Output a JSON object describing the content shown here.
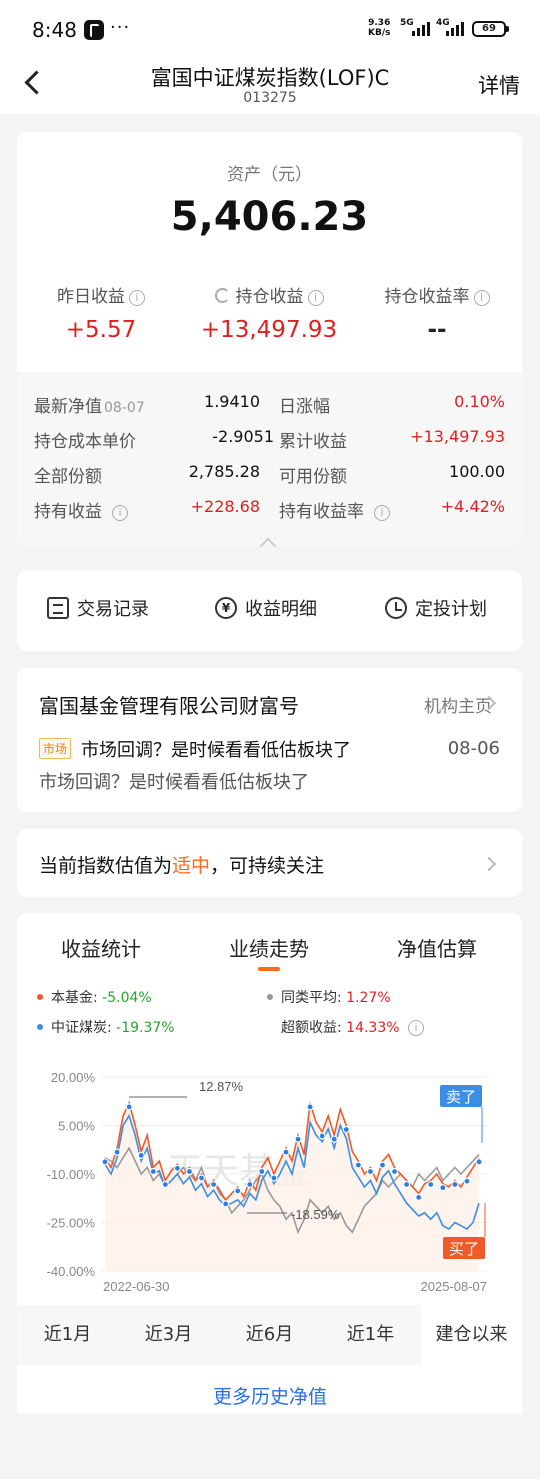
{
  "status": {
    "time": "8:48",
    "dots": "···",
    "net_speed_top": "9.36",
    "net_speed_bottom": "KB/s",
    "sig1": "5G",
    "sig2": "4G",
    "battery": "69"
  },
  "nav": {
    "title": "富国中证煤炭指数(LOF)C",
    "code": "013275",
    "detail": "详情"
  },
  "assets": {
    "label": "资产（元）",
    "value": "5,406.23",
    "stats": [
      {
        "label": "昨日收益",
        "value": "+5.57"
      },
      {
        "label": "持仓收益",
        "value": "+13,497.93"
      },
      {
        "label": "持仓收益率",
        "value": "--"
      }
    ]
  },
  "details": {
    "rows": [
      {
        "l_label": "最新净值",
        "l_sub": "08-07",
        "l_value": "1.9410",
        "r_label": "日涨幅",
        "r_value": "0.10%"
      },
      {
        "l_label": "持仓成本单价",
        "l_sub": "",
        "l_value": "-2.9051",
        "r_label": "累计收益",
        "r_value": "+13,497.93"
      },
      {
        "l_label": "全部份额",
        "l_sub": "",
        "l_value": "2,785.28",
        "r_label": "可用份额",
        "r_value": "100.00"
      },
      {
        "l_label": "持有收益",
        "l_sub": "",
        "l_value": "+228.68",
        "r_label": "持有收益率",
        "r_value": "+4.42%"
      }
    ]
  },
  "actions": [
    "交易记录",
    "收益明细",
    "定投计划"
  ],
  "wealth": {
    "title": "富国基金管理有限公司财富号",
    "link": "机构主页",
    "tag": "市场",
    "news_title": "市场回调？是时候看看低估板块了",
    "news_date": "08-06",
    "news_sub": "市场回调？是时候看看低估板块了"
  },
  "valuation": {
    "prefix": "当前指数估值为",
    "highlight": "适中",
    "suffix": "，可持续关注"
  },
  "perf": {
    "tabs": [
      "收益统计",
      "业绩走势",
      "净值估算"
    ],
    "active_tab": 1,
    "legend": [
      {
        "name": "本基金:",
        "value": "-5.04%",
        "color": "#f05a28",
        "value_color": "#2aa52a"
      },
      {
        "name": "同类平均:",
        "value": "1.27%",
        "color": "#999999",
        "value_color": "#e02020"
      },
      {
        "name": "中证煤炭:",
        "value": "-19.37%",
        "color": "#3a8ee6",
        "value_color": "#2aa52a"
      },
      {
        "name": "超额收益:",
        "value": "14.33%",
        "color": "",
        "value_color": "#e02020"
      }
    ],
    "ranges": [
      "近1月",
      "近3月",
      "近6月",
      "近1年",
      "建仓以来"
    ],
    "active_range": 4,
    "more": "更多历史净值"
  },
  "chart_data": {
    "type": "line",
    "y_ticks": [
      "20.00%",
      "5.00%",
      "-10.00%",
      "-25.00%",
      "-40.00%"
    ],
    "ylim": [
      -40,
      20
    ],
    "x_start": "2022-06-30",
    "x_end": "2025-08-07",
    "annotations": {
      "max": "12.87%",
      "min": "-18.59%",
      "sell": "卖了",
      "buy": "买了"
    },
    "watermark": "天天基金",
    "series": [
      {
        "name": "本基金",
        "color": "#f05a28",
        "values": [
          -5,
          -8,
          -2,
          8,
          12,
          5,
          -3,
          2,
          -8,
          -6,
          -12,
          -9,
          -7,
          -10,
          -8,
          -12,
          -10,
          -14,
          -12,
          -15,
          -18,
          -16,
          -14,
          -17,
          -12,
          -15,
          -8,
          -5,
          -10,
          -6,
          -2,
          -6,
          2,
          -4,
          12,
          6,
          3,
          8,
          2,
          10,
          5,
          -3,
          -6,
          -10,
          -8,
          -12,
          -6,
          -4,
          -8,
          -10,
          -12,
          -14,
          -16,
          -13,
          -12,
          -10,
          -13,
          -14,
          -12,
          -14,
          -11,
          -8,
          -5
        ]
      },
      {
        "name": "同类平均",
        "color": "#999999",
        "values": [
          -5,
          -6,
          -8,
          -5,
          -2,
          -6,
          -10,
          -8,
          -12,
          -10,
          -14,
          -12,
          -10,
          -8,
          -10,
          -12,
          -8,
          -14,
          -12,
          -16,
          -18,
          -22,
          -20,
          -18,
          -15,
          -12,
          -10,
          -15,
          -18,
          -20,
          -24,
          -22,
          -28,
          -24,
          -18,
          -20,
          -22,
          -20,
          -24,
          -22,
          -26,
          -28,
          -24,
          -20,
          -18,
          -16,
          -12,
          -14,
          -12,
          -10,
          -12,
          -14,
          -10,
          -12,
          -10,
          -8,
          -12,
          -10,
          -8,
          -10,
          -8,
          -6,
          -4
        ]
      },
      {
        "name": "中证煤炭",
        "color": "#3a8ee6",
        "values": [
          -7,
          -10,
          -5,
          5,
          8,
          2,
          -6,
          -2,
          -10,
          -9,
          -14,
          -12,
          -10,
          -13,
          -11,
          -15,
          -13,
          -17,
          -15,
          -18,
          -20,
          -19,
          -18,
          -20,
          -16,
          -18,
          -12,
          -9,
          -13,
          -10,
          -6,
          -10,
          -2,
          -8,
          6,
          2,
          0,
          4,
          -2,
          5,
          1,
          -8,
          -11,
          -14,
          -12,
          -16,
          -11,
          -9,
          -13,
          -16,
          -19,
          -21,
          -23,
          -22,
          -24,
          -22,
          -26,
          -27,
          -25,
          -26,
          -27,
          -25,
          -19
        ]
      }
    ]
  }
}
